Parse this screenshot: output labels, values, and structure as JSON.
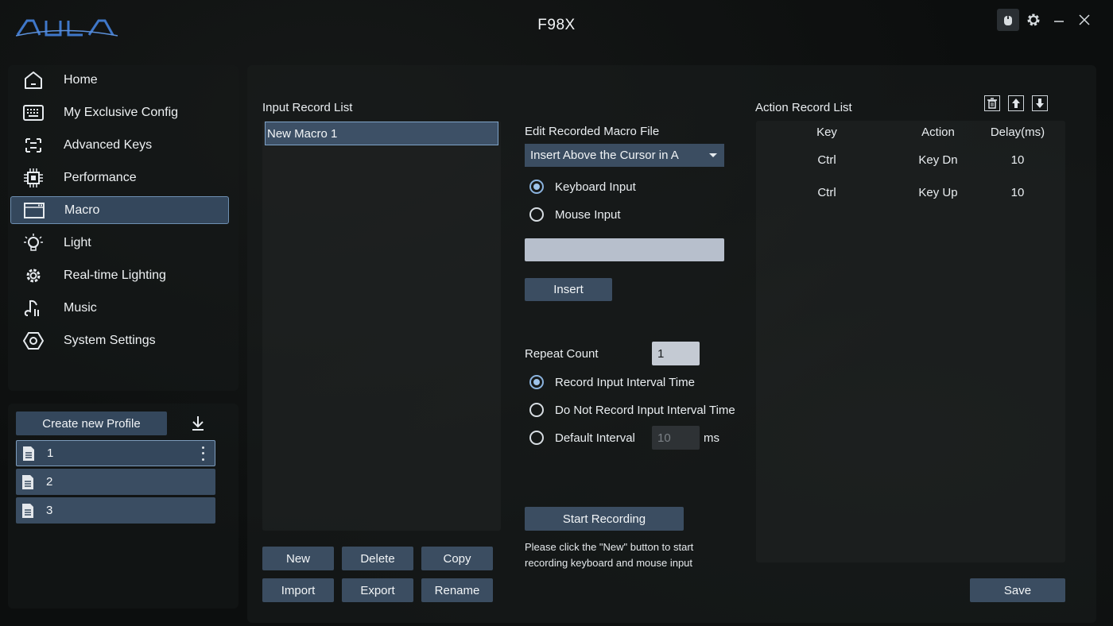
{
  "app": {
    "logo_text": "AULA",
    "title": "F98X"
  },
  "window": {
    "icons": [
      "mouse-icon",
      "gear-icon",
      "minimize-icon",
      "close-icon"
    ]
  },
  "nav": {
    "items": [
      {
        "label": "Home",
        "icon": "home-icon"
      },
      {
        "label": "My Exclusive Config",
        "icon": "keyboard-icon"
      },
      {
        "label": "Advanced Keys",
        "icon": "advanced-keys-icon"
      },
      {
        "label": "Performance",
        "icon": "chip-icon"
      },
      {
        "label": "Macro",
        "icon": "macro-window-icon",
        "active": true
      },
      {
        "label": "Light",
        "icon": "bulb-icon"
      },
      {
        "label": "Real-time Lighting",
        "icon": "realtime-lighting-icon"
      },
      {
        "label": "Music",
        "icon": "music-icon"
      },
      {
        "label": "System Settings",
        "icon": "hexagon-settings-icon"
      }
    ]
  },
  "profiles": {
    "create_label": "Create new Profile",
    "items": [
      {
        "name": "1",
        "active": true
      },
      {
        "name": "2"
      },
      {
        "name": "3"
      }
    ]
  },
  "macro": {
    "input_record_list_label": "Input Record List",
    "records": [
      "New Macro 1"
    ],
    "buttons": {
      "new": "New",
      "delete": "Delete",
      "copy": "Copy",
      "import": "Import",
      "export": "Export",
      "rename": "Rename"
    },
    "edit_label": "Edit Recorded Macro File",
    "insert_mode": "Insert Above the Cursor in A",
    "input_type": {
      "keyboard": "Keyboard Input",
      "mouse": "Mouse Input",
      "selected": "keyboard"
    },
    "key_input_value": "",
    "insert_label": "Insert",
    "repeat_count_label": "Repeat Count",
    "repeat_count": "1",
    "interval": {
      "record": "Record Input Interval Time",
      "no_record": "Do Not Record Input Interval Time",
      "default": "Default Interval",
      "default_value": "10",
      "unit": "ms",
      "selected": "record"
    },
    "start_recording_label": "Start Recording",
    "hint": "Please click the \"New\" button to start recording keyboard and mouse input"
  },
  "action_list": {
    "title": "Action Record List",
    "columns": [
      "Key",
      "Action",
      "Delay(ms)"
    ],
    "rows": [
      {
        "key": "Ctrl",
        "action": "Key Dn",
        "delay": "10"
      },
      {
        "key": "Ctrl",
        "action": "Key Up",
        "delay": "10"
      }
    ]
  },
  "save_label": "Save",
  "colors": {
    "accent": "#34475c",
    "accent_border": "#7ea3c8",
    "radio_checked": "#9ec3ea"
  }
}
